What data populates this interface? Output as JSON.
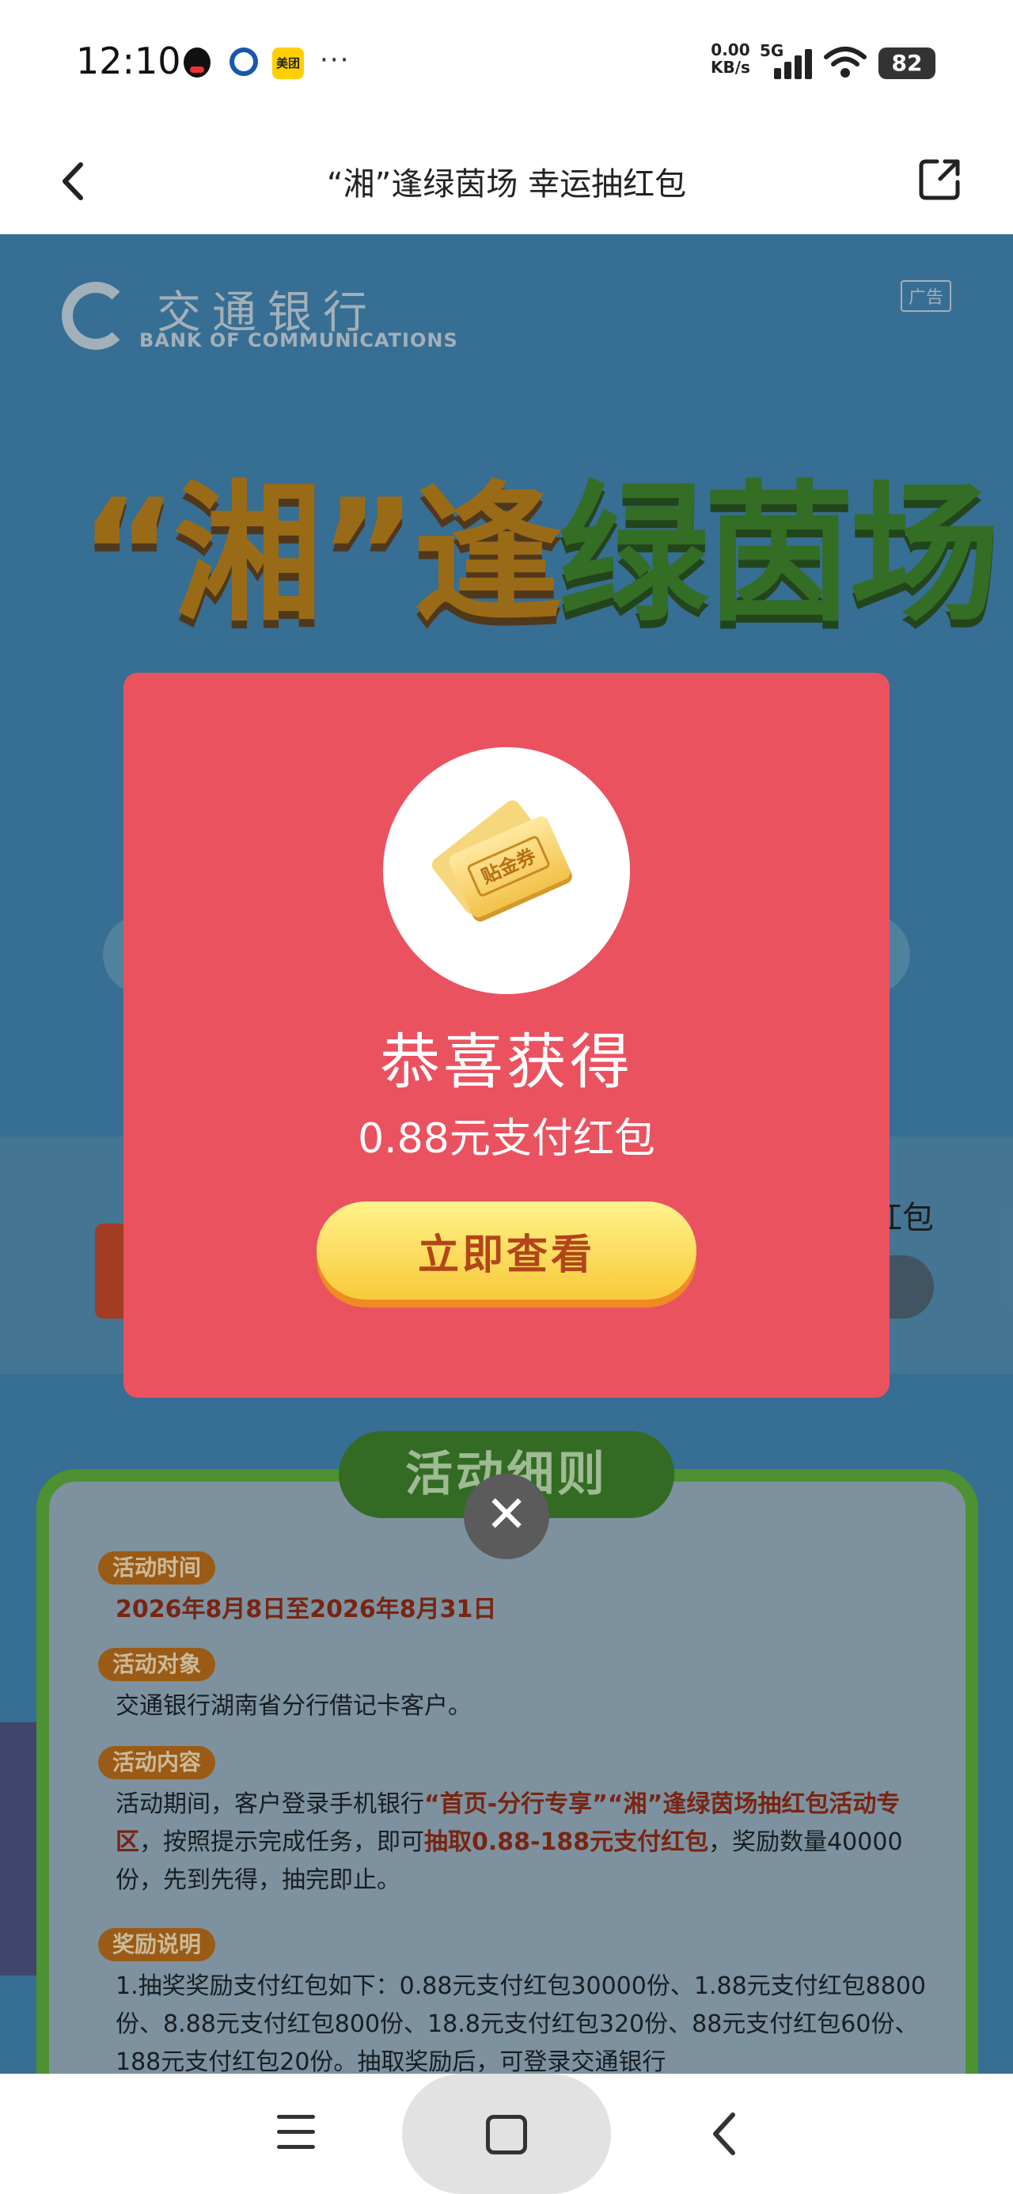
{
  "status_bar": {
    "time": "12:10",
    "net_speed": "0.00",
    "net_unit": "KB/s",
    "network": "5G",
    "battery": "82",
    "meituan": "美团",
    "more": "···"
  },
  "titlebar": {
    "title": "“湘”逢绿茵场 幸运抽红包"
  },
  "banner": {
    "bank_name": "交通银行",
    "bank_en": "BANK OF COMMUNICATIONS",
    "ad_label": "广告",
    "hero_part1": "“湘”逢",
    "hero_part2": "绿茵场"
  },
  "background": {
    "band_text": "红包"
  },
  "rules": {
    "heading": "活动细则",
    "time_tag": "活动时间",
    "time_value": "2026年8月8日至2026年8月31日",
    "target_tag": "活动对象",
    "target_value": "交通银行湖南省分行借记卡客户。",
    "content_tag": "活动内容",
    "content_p1": "活动期间，客户登录手机银行",
    "content_hl1": "“首页-分行专享”“湘”逢绿茵场抽红包活动专区",
    "content_p2": "，按照提示完成任务，即可",
    "content_hl2": "抽取0.88-188元支付红包",
    "content_p3": "，奖励数量40000份，先到先得，抽完即止。",
    "reward_tag": "奖励说明",
    "reward_value": "1.抽奖奖励支付红包如下：0.88元支付红包30000份、1.88元支付红包8800份、8.88元支付红包800份、18.8元支付红包320份、88元支付红包60份、188元支付红包20份。抽取奖励后，可登录交通银行"
  },
  "modal": {
    "ticket_label": "贴金券",
    "title": "恭喜获得",
    "prize": "0.88元支付红包",
    "button": "立即查看",
    "close": "✕"
  }
}
